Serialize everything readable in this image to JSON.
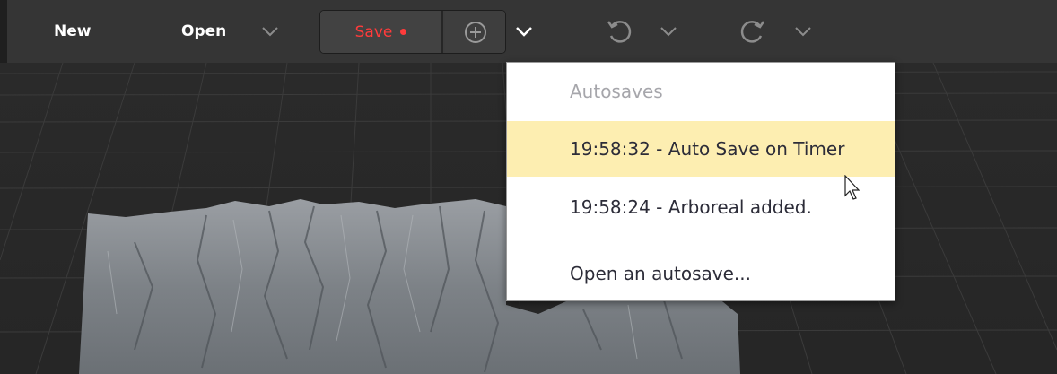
{
  "colors": {
    "toolbar_bg": "#353535",
    "save_accent": "#ff3b3b",
    "highlight": "#fdeeb1",
    "menu_text": "#2c2c38",
    "menu_header": "#a6a6ab"
  },
  "toolbar": {
    "new_label": "New",
    "open_label": "Open",
    "open_menu_icon": "chevron-down-icon",
    "save_label": "Save",
    "save_status_icon": "unsaved-dot-icon",
    "add_icon": "plus-circle-icon",
    "save_menu_icon": "chevron-down-icon",
    "undo_icon": "undo-icon",
    "undo_menu_icon": "chevron-down-icon",
    "redo_icon": "redo-icon",
    "redo_menu_icon": "chevron-down-icon"
  },
  "autosave_menu": {
    "header": "Autosaves",
    "items": [
      {
        "label": "19:58:32 - Auto Save on Timer",
        "highlighted": true
      },
      {
        "label": "19:58:24 - Arboreal added.",
        "highlighted": false
      }
    ],
    "open_label": "Open an autosave..."
  },
  "viewport": {
    "content": "terrain-preview",
    "grid": true
  }
}
